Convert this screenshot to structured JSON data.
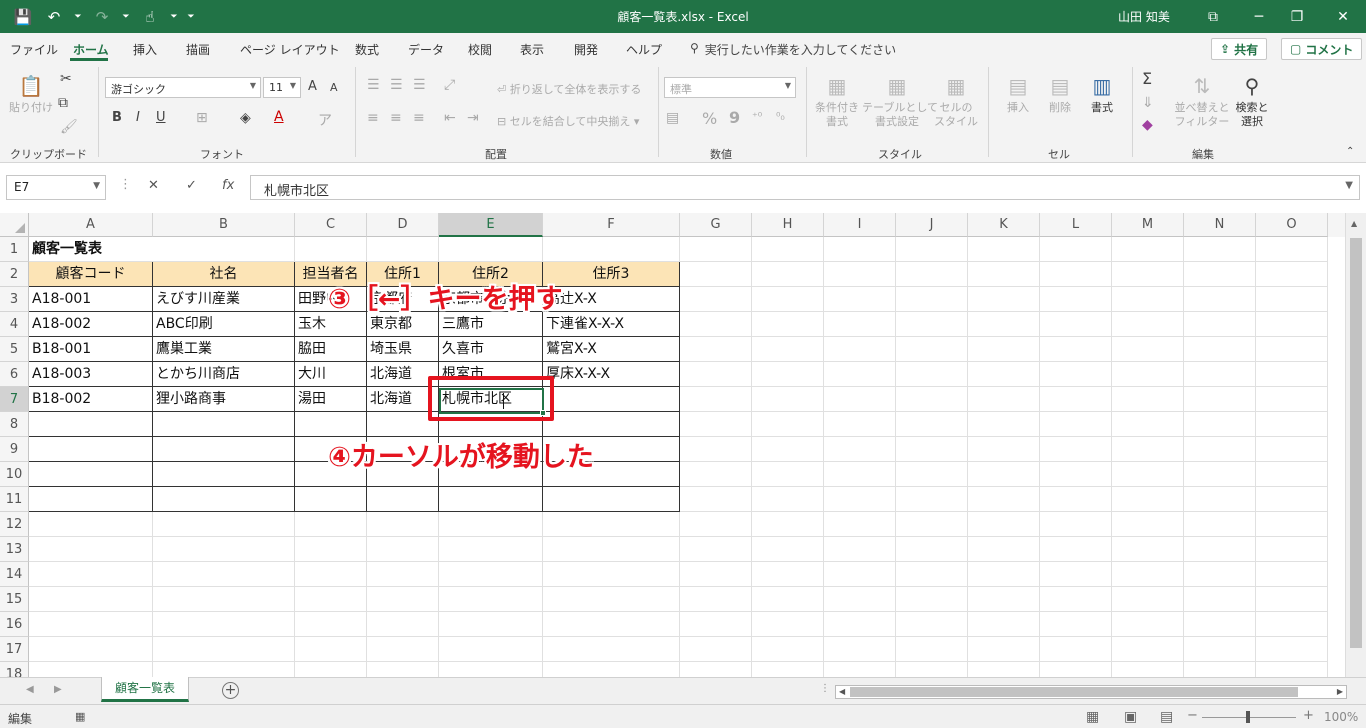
{
  "window": {
    "title": "顧客一覧表.xlsx  -  Excel",
    "user": "山田 知美"
  },
  "quick_access": {
    "save_icon": "💾",
    "undo_icon": "↶",
    "redo_icon": "↷",
    "touch_icon": "☝",
    "customize_icon": "⏷"
  },
  "window_controls": {
    "ribbon_options": "⧉",
    "minimize": "─",
    "restore": "❐",
    "close": "✕"
  },
  "menu": {
    "tabs": [
      "ファイル",
      "ホーム",
      "挿入",
      "描画",
      "ページ レイアウト",
      "数式",
      "データ",
      "校閲",
      "表示",
      "開発",
      "ヘルプ"
    ],
    "active": "ホーム",
    "tell_me": "実行したい作業を入力してください",
    "share": "共有",
    "comment": "コメント"
  },
  "ribbon": {
    "clipboard": {
      "paste": "貼り付け",
      "label": "クリップボード"
    },
    "font": {
      "name": "游ゴシック",
      "size": "11",
      "grow": "A",
      "shrink": "A",
      "bold": "B",
      "italic": "I",
      "underline": "U",
      "font_color": "A",
      "label": "フォント"
    },
    "alignment": {
      "wrap": "折り返して全体を表示する",
      "merge": "セルを結合して中央揃え",
      "label": "配置"
    },
    "number": {
      "format": "標準",
      "percent": "%",
      "comma": "9",
      "label": "数値"
    },
    "styles": {
      "conditional": "条件付き\n書式",
      "table": "テーブルとして\n書式設定",
      "cell_styles": "セルの\nスタイル",
      "label": "スタイル"
    },
    "cells": {
      "insert": "挿入",
      "delete": "削除",
      "format": "書式",
      "label": "セル"
    },
    "editing": {
      "sum": "Σ",
      "sort": "並べ替えと\nフィルター",
      "find": "検索と\n選択",
      "label": "編集"
    }
  },
  "formula_bar": {
    "name_box": "E7",
    "cancel": "✕",
    "enter": "✓",
    "fx": "fx",
    "content": "札幌市北区"
  },
  "columns": [
    "A",
    "B",
    "C",
    "D",
    "E",
    "F",
    "G",
    "H",
    "I",
    "J",
    "K",
    "L",
    "M",
    "N",
    "O"
  ],
  "rows": [
    "1",
    "2",
    "3",
    "4",
    "5",
    "6",
    "7",
    "8",
    "9",
    "10",
    "11",
    "12",
    "13",
    "14",
    "15",
    "16",
    "17",
    "18"
  ],
  "sheet": {
    "title": "顧客一覧表",
    "headers": [
      "顧客コード",
      "社名",
      "担当者名",
      "住所1",
      "住所2",
      "住所3"
    ],
    "data": [
      [
        "A18-001",
        "えびす川産業",
        "田野中",
        "京都府",
        "京都市下京区",
        "高辻X-X"
      ],
      [
        "A18-002",
        "ABC印刷",
        "玉木",
        "東京都",
        "三鷹市",
        "下連雀X-X-X"
      ],
      [
        "B18-001",
        "鷹巣工業",
        "脇田",
        "埼玉県",
        "久喜市",
        "鷲宮X-X"
      ],
      [
        "A18-003",
        "とかち川商店",
        "大川",
        "北海道",
        "根室市",
        "厚床X-X-X"
      ],
      [
        "B18-002",
        "狸小路商事",
        "湯田",
        "北海道",
        "札幌市北区",
        ""
      ]
    ]
  },
  "annotations": {
    "step3": "③［←］キーを押す",
    "step4": "④カーソルが移動した",
    "color": "#e5141f"
  },
  "sheet_tab": "顧客一覧表",
  "status": {
    "mode": "編集",
    "zoom": "100%"
  },
  "theme": {
    "accent": "#217346",
    "header_fill": "#fce4b6"
  }
}
